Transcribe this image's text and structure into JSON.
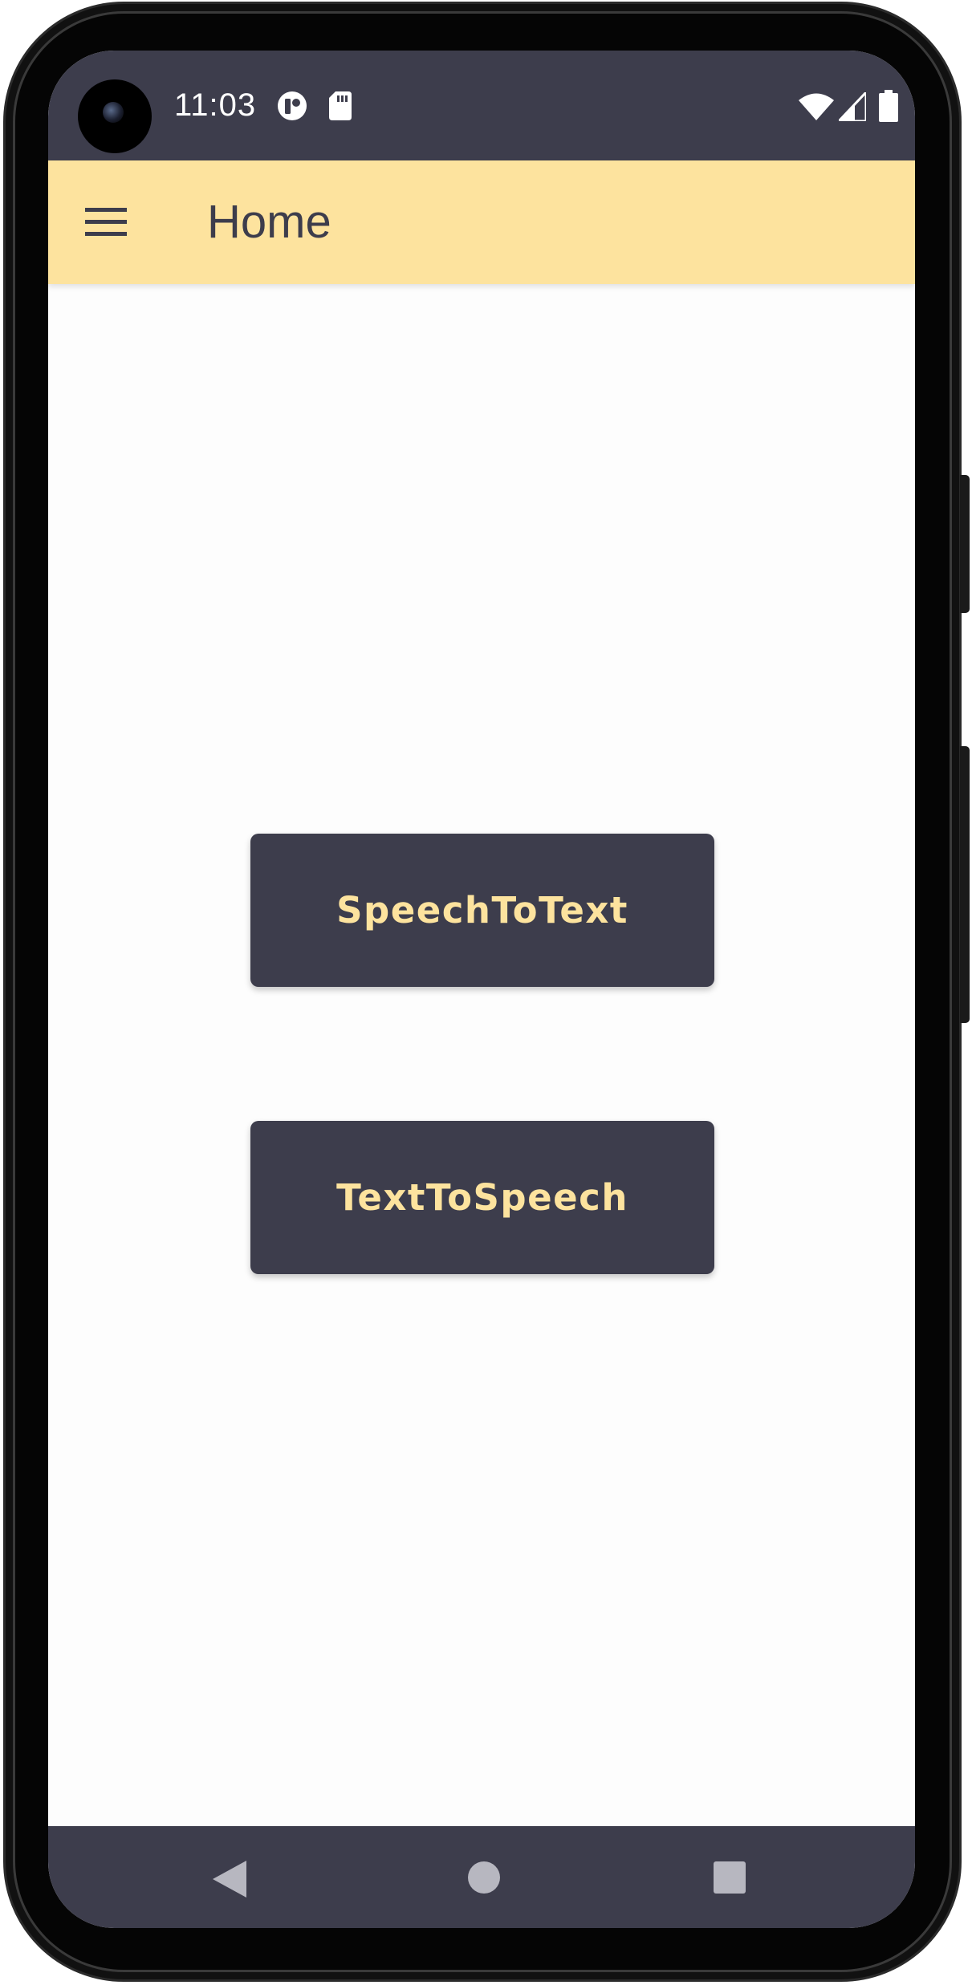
{
  "status_bar": {
    "time": "11:03",
    "icons": [
      "app-notification-icon",
      "sd-card-icon",
      "wifi-icon",
      "cell-signal-icon",
      "battery-icon"
    ]
  },
  "app_bar": {
    "title": "Home",
    "menu_icon": "hamburger-menu-icon",
    "background_color": "#fde39e"
  },
  "main": {
    "buttons": [
      {
        "label": "SpeechToText"
      },
      {
        "label": "TextToSpeech"
      }
    ],
    "button_color": "#3d3d4c",
    "button_text_color": "#fde39e"
  },
  "nav_bar": {
    "buttons": [
      "back-icon",
      "home-icon",
      "recents-icon"
    ]
  },
  "colors": {
    "dark": "#3d3d4c",
    "accent": "#fde39e",
    "background": "#fdfdfd"
  }
}
